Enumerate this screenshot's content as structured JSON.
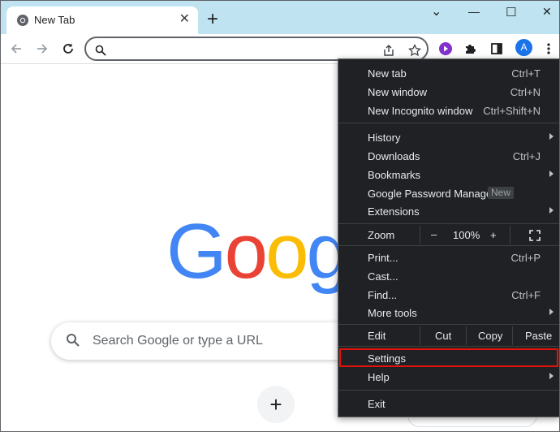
{
  "tab": {
    "title": "New Tab",
    "close": "✕"
  },
  "new_tab_button": "+",
  "window_controls": {
    "collapse": "⌄",
    "minimize": "—",
    "maximize": "☐",
    "close": "✕"
  },
  "avatar_initial": "A",
  "page": {
    "logo_letters": [
      {
        "ch": "G",
        "color": "#4285f4"
      },
      {
        "ch": "o",
        "color": "#ea4335"
      },
      {
        "ch": "o",
        "color": "#fbbc05"
      },
      {
        "ch": "g",
        "color": "#4285f4"
      }
    ],
    "search_placeholder": "Search Google or type a URL",
    "add_shortcut": "+"
  },
  "menu": {
    "new_tab": {
      "label": "New tab",
      "shortcut": "Ctrl+T"
    },
    "new_window": {
      "label": "New window",
      "shortcut": "Ctrl+N"
    },
    "new_incognito": {
      "label": "New Incognito window",
      "shortcut": "Ctrl+Shift+N"
    },
    "history": {
      "label": "History"
    },
    "downloads": {
      "label": "Downloads",
      "shortcut": "Ctrl+J"
    },
    "bookmarks": {
      "label": "Bookmarks"
    },
    "password_manager": {
      "label": "Google Password Manager",
      "badge": "New"
    },
    "extensions": {
      "label": "Extensions"
    },
    "zoom": {
      "label": "Zoom",
      "minus": "–",
      "value": "100%",
      "plus": "+"
    },
    "print": {
      "label": "Print...",
      "shortcut": "Ctrl+P"
    },
    "cast": {
      "label": "Cast..."
    },
    "find": {
      "label": "Find...",
      "shortcut": "Ctrl+F"
    },
    "more_tools": {
      "label": "More tools"
    },
    "edit": {
      "label": "Edit",
      "cut": "Cut",
      "copy": "Copy",
      "paste": "Paste"
    },
    "settings": {
      "label": "Settings"
    },
    "help": {
      "label": "Help"
    },
    "exit": {
      "label": "Exit"
    }
  },
  "colors": {
    "tabstrip": "#bfe3f0",
    "menu_bg": "#202124",
    "highlight": "#e3120b",
    "extension_purple": "#8430ce"
  }
}
